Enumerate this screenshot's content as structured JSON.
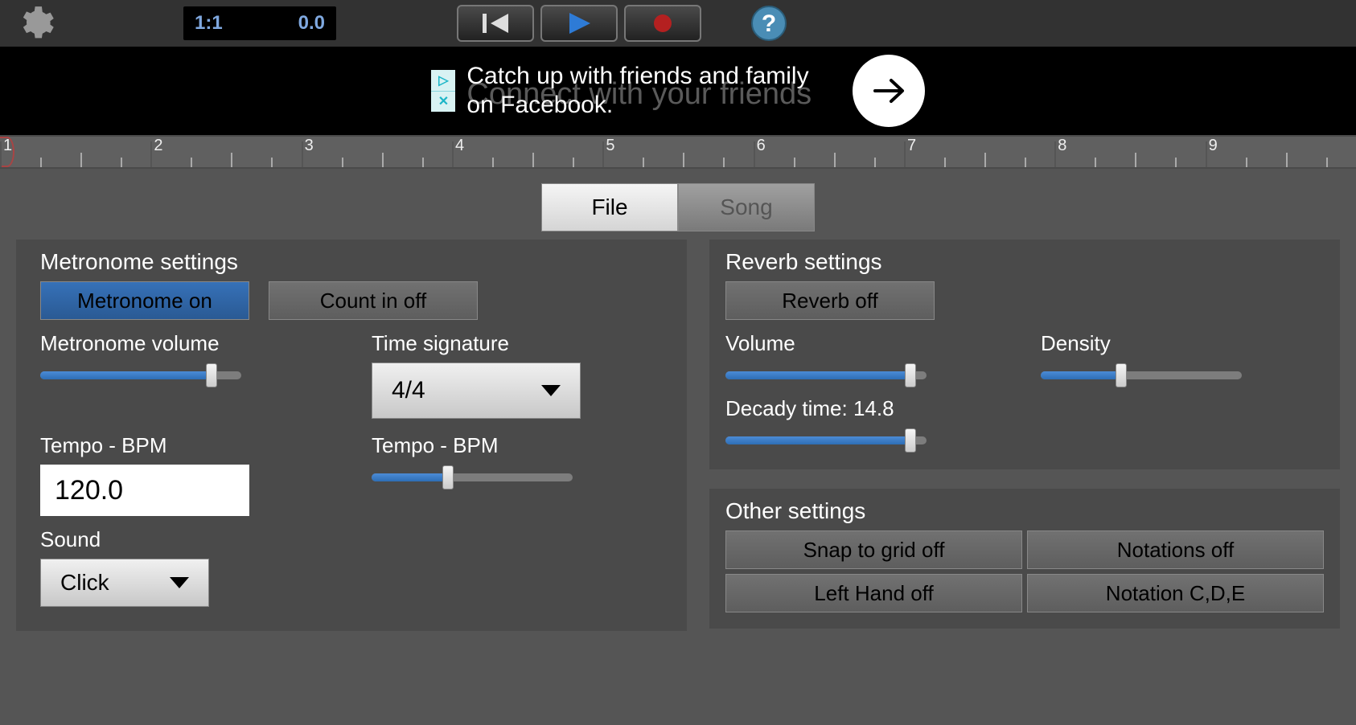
{
  "toolbar": {
    "position": "1:1",
    "time": "0.0"
  },
  "ad": {
    "text_line1": "Catch up with friends and family",
    "text_line2": "on Facebook.",
    "shadow_text": "Connect with your friends"
  },
  "ruler": {
    "marks": [
      "1",
      "2",
      "3",
      "4",
      "5",
      "6",
      "7",
      "8",
      "9"
    ]
  },
  "tabs": {
    "file": "File",
    "song": "Song"
  },
  "metronome": {
    "title": "Metronome settings",
    "on_btn": "Metronome on",
    "countin_btn": "Count in off",
    "volume_label": "Metronome volume",
    "volume_pct": 85,
    "timesig_label": "Time signature",
    "timesig_value": "4/4",
    "tempo_label_left": "Tempo - BPM",
    "tempo_value": "120.0",
    "tempo_label_right": "Tempo - BPM",
    "tempo_slider_pct": 38,
    "sound_label": "Sound",
    "sound_value": "Click"
  },
  "reverb": {
    "title": "Reverb settings",
    "off_btn": "Reverb off",
    "volume_label": "Volume",
    "volume_pct": 92,
    "density_label": "Density",
    "density_pct": 40,
    "decay_label": "Decady time: 14.8",
    "decay_pct": 92
  },
  "other": {
    "title": "Other settings",
    "snap": "Snap to grid off",
    "notations": "Notations off",
    "lefthand": "Left Hand off",
    "notationcde": "Notation C,D,E"
  }
}
